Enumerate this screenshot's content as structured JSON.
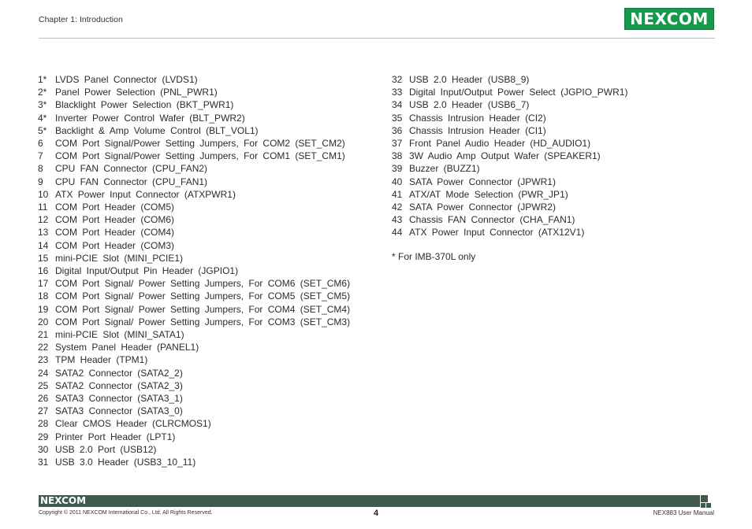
{
  "header": {
    "chapter": "Chapter 1: Introduction",
    "logo_text": "NEXCOM"
  },
  "left_items": [
    {
      "num": "1*",
      "text": "LVDS Panel Connector (LVDS1)"
    },
    {
      "num": "2*",
      "text": "Panel Power Selection (PNL_PWR1)"
    },
    {
      "num": "3*",
      "text": "Blacklight Power Selection (BKT_PWR1)"
    },
    {
      "num": "4*",
      "text": "Inverter Power Control Wafer (BLT_PWR2)"
    },
    {
      "num": "5*",
      "text": "Backlight & Amp Volume Control (BLT_VOL1)"
    },
    {
      "num": "6",
      "text": "COM Port Signal/Power Setting Jumpers, For COM2 (SET_CM2)"
    },
    {
      "num": "7",
      "text": "COM Port Signal/Power Setting Jumpers, For COM1 (SET_CM1)"
    },
    {
      "num": "8",
      "text": "CPU FAN Connector (CPU_FAN2)"
    },
    {
      "num": "9",
      "text": "CPU FAN Connector (CPU_FAN1)"
    },
    {
      "num": "10",
      "text": "ATX Power Input Connector (ATXPWR1)"
    },
    {
      "num": "11",
      "text": "COM Port Header (COM5)"
    },
    {
      "num": "12",
      "text": "COM Port Header (COM6)"
    },
    {
      "num": "13",
      "text": "COM Port Header (COM4)"
    },
    {
      "num": "14",
      "text": "COM Port Header (COM3)"
    },
    {
      "num": "15",
      "text": "mini-PCIE Slot (MINI_PCIE1)"
    },
    {
      "num": "16",
      "text": "Digital Input/Output Pin Header (JGPIO1)"
    },
    {
      "num": "17",
      "text": "COM Port Signal/ Power Setting Jumpers, For COM6 (SET_CM6)"
    },
    {
      "num": "18",
      "text": "COM Port Signal/ Power Setting Jumpers, For COM5 (SET_CM5)"
    },
    {
      "num": "19",
      "text": "COM Port Signal/ Power Setting Jumpers, For COM4 (SET_CM4)"
    },
    {
      "num": "20",
      "text": "COM Port Signal/ Power Setting Jumpers, For COM3 (SET_CM3)"
    },
    {
      "num": "21",
      "text": "mini-PCIE Slot (MINI_SATA1)"
    },
    {
      "num": "22",
      "text": "System Panel Header (PANEL1)"
    },
    {
      "num": "23",
      "text": "TPM Header (TPM1)"
    },
    {
      "num": "24",
      "text": "SATA2 Connector (SATA2_2)"
    },
    {
      "num": "25",
      "text": "SATA2 Connector (SATA2_3)"
    },
    {
      "num": "26",
      "text": "SATA3 Connector (SATA3_1)"
    },
    {
      "num": "27",
      "text": "SATA3 Connector (SATA3_0)"
    },
    {
      "num": "28",
      "text": "Clear CMOS Header (CLRCMOS1)"
    },
    {
      "num": "29",
      "text": "Printer Port Header (LPT1)"
    },
    {
      "num": "30",
      "text": "USB 2.0 Port (USB12)"
    },
    {
      "num": "31",
      "text": "USB 3.0 Header (USB3_10_11)"
    }
  ],
  "right_items": [
    {
      "num": "32",
      "text": "USB 2.0 Header (USB8_9)"
    },
    {
      "num": "33",
      "text": "Digital Input/Output Power Select (JGPIO_PWR1)"
    },
    {
      "num": "34",
      "text": "USB 2.0 Header (USB6_7)"
    },
    {
      "num": "35",
      "text": "Chassis Intrusion Header (CI2)"
    },
    {
      "num": "36",
      "text": "Chassis Intrusion Header (CI1)"
    },
    {
      "num": "37",
      "text": "Front Panel Audio Header (HD_AUDIO1)"
    },
    {
      "num": "38",
      "text": "3W Audio Amp Output Wafer (SPEAKER1)"
    },
    {
      "num": "39",
      "text": "Buzzer (BUZZ1)"
    },
    {
      "num": "40",
      "text": "SATA Power Connector (JPWR1)"
    },
    {
      "num": "41",
      "text": "ATX/AT Mode Selection (PWR_JP1)"
    },
    {
      "num": "42",
      "text": "SATA Power Connector (JPWR2)"
    },
    {
      "num": "43",
      "text": "Chassis FAN Connector (CHA_FAN1)"
    },
    {
      "num": "44",
      "text": "ATX Power Input Connector (ATX12V1)"
    }
  ],
  "note": "* For IMB-370L only",
  "footer": {
    "logo_text": "NEXCOM",
    "copyright": "Copyright © 2011 NEXCOM International Co., Ltd. All Rights Reserved.",
    "page_number": "4",
    "manual_name": "NEX883 User Manual"
  }
}
